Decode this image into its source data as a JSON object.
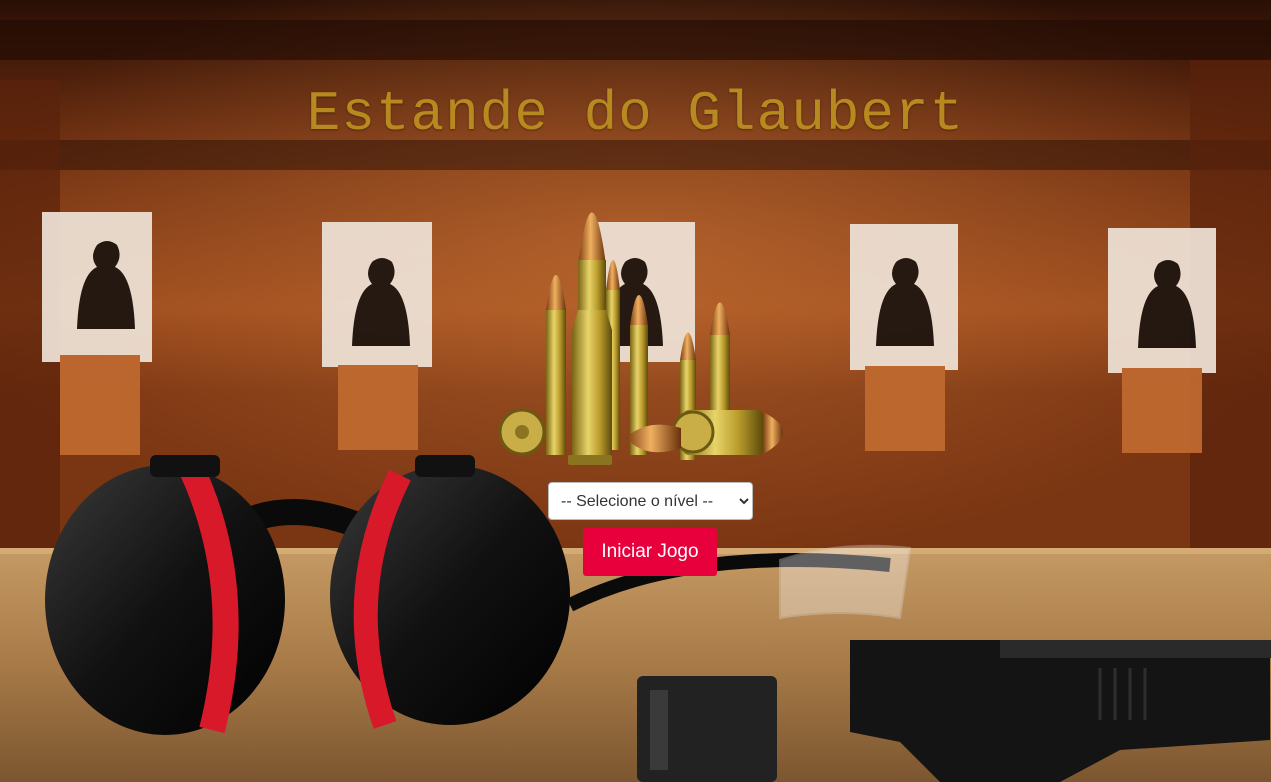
{
  "title": "Estande do Glaubert",
  "level_select": {
    "selected": "-- Selecione o nível --",
    "options": [
      "-- Selecione o nível --"
    ]
  },
  "start_button_label": "Iniciar Jogo",
  "colors": {
    "title": "#b8891f",
    "button": "#e8003d"
  }
}
